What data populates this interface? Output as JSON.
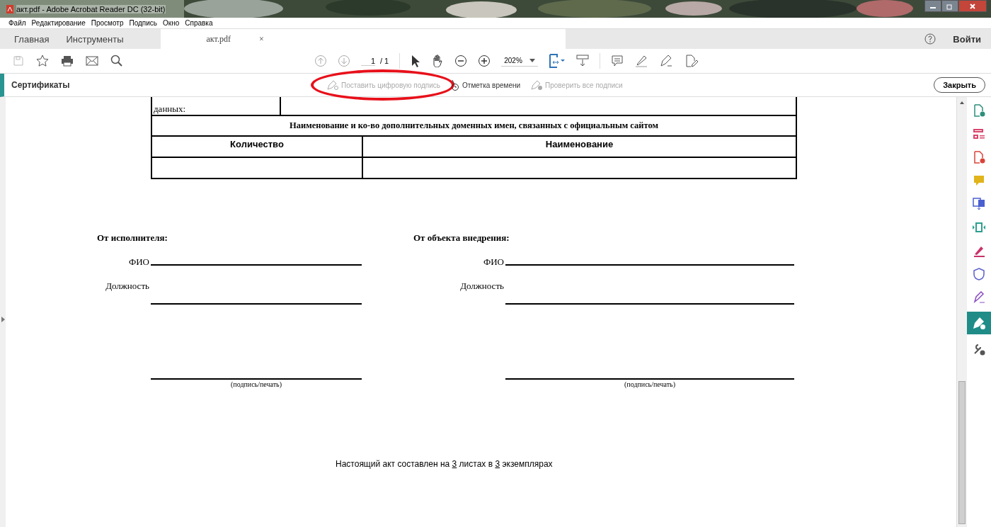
{
  "window": {
    "title": "акт.pdf - Adobe Acrobat Reader DC (32-bit)"
  },
  "menu": [
    "Файл",
    "Редактирование",
    "Просмотр",
    "Подпись",
    "Окно",
    "Справка"
  ],
  "tabs": [
    {
      "label": "Главная",
      "kind": "nav",
      "selected": false
    },
    {
      "label": "Инструменты",
      "kind": "nav",
      "selected": false
    },
    {
      "label": "акт.pdf",
      "kind": "document",
      "selected": true,
      "close": "×"
    }
  ],
  "account": {
    "login": "Войти"
  },
  "toolbar": {
    "page": "1",
    "page_total": "/ 1",
    "zoom": "202%"
  },
  "panel": {
    "title": "Сертификаты",
    "close": "Закрыть",
    "actions": [
      {
        "label": "Поставить цифровую подпись",
        "kind": "sign",
        "disabled": true,
        "circled": true
      },
      {
        "label": "Отметка времени",
        "kind": "clock",
        "disabled": false,
        "circled": false
      },
      {
        "label": "Проверить все подписи",
        "kind": "verify",
        "disabled": true,
        "circled": false
      }
    ]
  },
  "document": {
    "cut_cell": "данных:",
    "table_title": "Наименование и ко-во дополнительных доменных имен, связанных с официальным сайтом",
    "columns": [
      "Количество",
      "Наименование"
    ],
    "signatures": [
      {
        "party": "От исполнителя:",
        "name_label": "ФИО",
        "position_label": "Должность",
        "sign_caption": "(подпись/печать)"
      },
      {
        "party": "От объекта внедрения:",
        "name_label": "ФИО",
        "position_label": "Должность",
        "sign_caption": "(подпись/печать)"
      }
    ],
    "footer": [
      {
        "text": "Настоящий акт составлен на ",
        "underlined": false
      },
      {
        "text": "3",
        "underlined": true
      },
      {
        "text": " листах в ",
        "underlined": false
      },
      {
        "text": "3",
        "underlined": true
      },
      {
        "text": " экземплярах",
        "underlined": false
      }
    ]
  },
  "tools": [
    {
      "kind": "export",
      "color": "#2d8f7b",
      "selected": false
    },
    {
      "kind": "organize",
      "color": "#d9446b",
      "selected": false
    },
    {
      "kind": "create",
      "color": "#d9443a",
      "selected": false
    },
    {
      "kind": "comment",
      "color": "#e0b41a",
      "selected": false
    },
    {
      "kind": "combine",
      "color": "#4a5fd0",
      "selected": false
    },
    {
      "kind": "compress",
      "color": "#2d9f8f",
      "selected": false
    },
    {
      "kind": "fill",
      "color": "#c8326b",
      "selected": false
    },
    {
      "kind": "protect",
      "color": "#5a5fc8",
      "selected": false
    },
    {
      "kind": "signature",
      "color": "#8a4fc0",
      "selected": false
    },
    {
      "kind": "certificate",
      "color": "#ffffff",
      "selected": true
    },
    {
      "kind": "more",
      "color": "#555555",
      "selected": false
    }
  ]
}
